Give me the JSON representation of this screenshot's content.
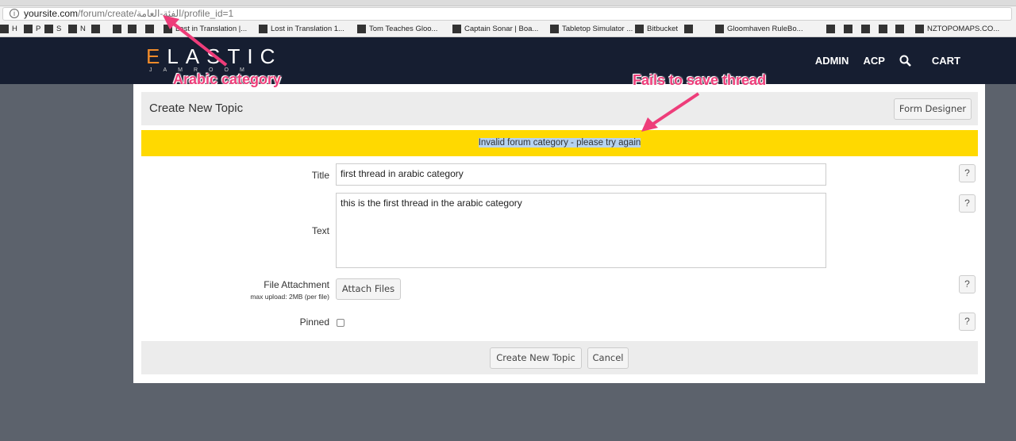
{
  "browser": {
    "url_host": "yoursite.com",
    "url_path": "/forum/create/الفئة-العامة/profile_id=1",
    "bookmarks": [
      "H",
      "P",
      "S",
      "N",
      "",
      "",
      "",
      "",
      "Lost in Translation |...",
      "Lost in Translation 1...",
      "Tom Teaches Gloo...",
      "Captain Sonar | Boa...",
      "Tabletop Simulator ...",
      "Bitbucket",
      "",
      "Gloomhaven RuleBo...",
      "",
      "",
      "",
      "",
      "",
      "NZTOPOMAPS.CO..."
    ]
  },
  "nav": {
    "logo_main": "LASTIC",
    "logo_initial": "E",
    "logo_sub": "JAMROOM",
    "items": [
      "ADMIN",
      "ACP",
      "CART"
    ]
  },
  "form": {
    "title": "Create New Topic",
    "form_designer": "Form Designer",
    "error": "Invalid forum category - please try again",
    "title_label": "Title",
    "title_value": "first thread in arabic category",
    "text_label": "Text",
    "text_value": "this is the first thread in the arabic category",
    "file_label": "File Attachment",
    "file_hint": "max upload: 2MB (per file)",
    "attach": "Attach Files",
    "pinned_label": "Pinned",
    "help": "?",
    "submit": "Create New Topic",
    "cancel": "Cancel"
  },
  "annotations": {
    "a1": "Arabic category",
    "a2": "Fails to save thread"
  }
}
